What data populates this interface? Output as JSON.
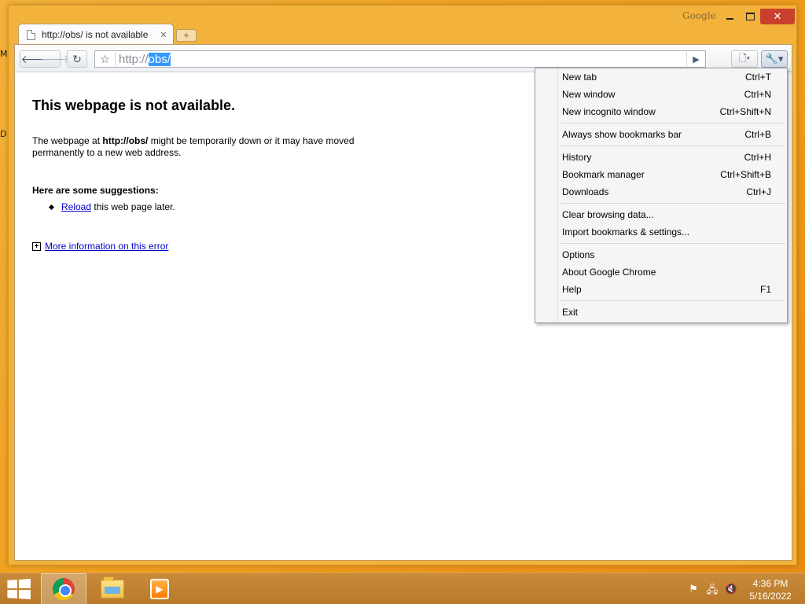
{
  "desktop": {
    "glyph_top": "M",
    "glyph_mid": "D"
  },
  "window": {
    "brand": "Google",
    "controls": {
      "minimize": "",
      "maximize": "",
      "close": "✕"
    }
  },
  "tab": {
    "title": "http://obs/ is not available",
    "close": "✕",
    "new_tab": "+"
  },
  "toolbar": {
    "back_icon": "🡐",
    "forward_icon": "🡒",
    "reload_icon": "↻",
    "star_icon": "☆",
    "url_prefix": "http://",
    "url_selected": "obs/",
    "go_icon": "▶",
    "page_menu_icon": "🗋▾",
    "wrench_icon": "🔧▾"
  },
  "content": {
    "title": "This webpage is not available.",
    "desc_prefix": "The webpage at ",
    "desc_url": "http://obs/",
    "desc_suffix": " might be temporarily down or it may have moved permanently to a new web address.",
    "suggestions_title": "Here are some suggestions:",
    "suggestion_link": "Reload",
    "suggestion_rest": " this web page later.",
    "more_info_plus": "+",
    "more_info_link": "More information on this error"
  },
  "menu": {
    "groups": [
      [
        {
          "label": "New tab",
          "shortcut": "Ctrl+T"
        },
        {
          "label": "New window",
          "shortcut": "Ctrl+N"
        },
        {
          "label": "New incognito window",
          "shortcut": "Ctrl+Shift+N"
        }
      ],
      [
        {
          "label": "Always show bookmarks bar",
          "shortcut": "Ctrl+B"
        }
      ],
      [
        {
          "label": "History",
          "shortcut": "Ctrl+H"
        },
        {
          "label": "Bookmark manager",
          "shortcut": "Ctrl+Shift+B"
        },
        {
          "label": "Downloads",
          "shortcut": "Ctrl+J"
        }
      ],
      [
        {
          "label": "Clear browsing data...",
          "shortcut": ""
        },
        {
          "label": "Import bookmarks & settings...",
          "shortcut": ""
        }
      ],
      [
        {
          "label": "Options",
          "shortcut": ""
        },
        {
          "label": "About Google Chrome",
          "shortcut": ""
        },
        {
          "label": "Help",
          "shortcut": "F1"
        }
      ],
      [
        {
          "label": "Exit",
          "shortcut": ""
        }
      ]
    ]
  },
  "taskbar": {
    "media_glyph": "▶",
    "tray": {
      "flag": "⚑",
      "network": "🖧",
      "volume": "🔇"
    },
    "time": "4:36 PM",
    "date": "5/16/2022"
  }
}
